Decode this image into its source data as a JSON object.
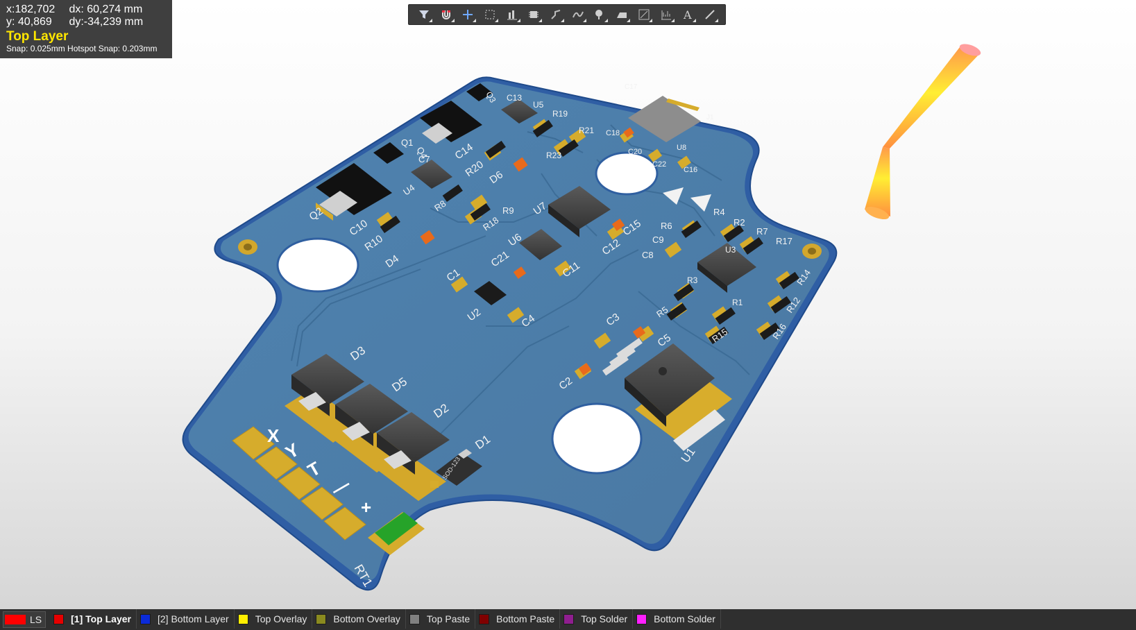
{
  "hud": {
    "x": "x:182,702",
    "dx": "dx: 60,274  mm",
    "y": "y: 40,869",
    "dy": "dy:-34,239  mm",
    "layer": "Top Layer",
    "snap": "Snap: 0.025mm Hotspot Snap: 0.203mm"
  },
  "toolbar": [
    {
      "name": "filter-icon"
    },
    {
      "name": "snap-magnet-icon"
    },
    {
      "name": "crosshair-icon"
    },
    {
      "name": "select-rect-icon"
    },
    {
      "name": "align-icon"
    },
    {
      "name": "component-icon"
    },
    {
      "name": "route-icon"
    },
    {
      "name": "diff-pair-icon"
    },
    {
      "name": "via-icon"
    },
    {
      "name": "polygon-icon"
    },
    {
      "name": "dimension-icon"
    },
    {
      "name": "graph-icon"
    },
    {
      "name": "text-icon"
    },
    {
      "name": "line-icon"
    }
  ],
  "silkscreen": {
    "labels": [
      "Q3",
      "C13",
      "U5",
      "R19",
      "R21",
      "C14",
      "R20",
      "D6",
      "R23",
      "Q4",
      "Q1",
      "C7",
      "U4",
      "R8",
      "R9",
      "R18",
      "Q2",
      "C10",
      "R10",
      "D4",
      "U7",
      "C15",
      "C12",
      "U6",
      "C21",
      "C11",
      "C1",
      "U2",
      "C4",
      "C18",
      "C20",
      "C22",
      "U8",
      "C16",
      "J1",
      "C17",
      "R4",
      "R6",
      "R2",
      "R7",
      "R17",
      "C9",
      "C8",
      "U3",
      "R3",
      "R5",
      "R1",
      "R14",
      "R12",
      "R15",
      "R16",
      "C3",
      "C5",
      "C2",
      "U1",
      "D3",
      "D5",
      "D2",
      "D1",
      "RT1",
      "SOD-123"
    ],
    "pin_marks": [
      "X",
      "Y",
      "T",
      "—",
      "+"
    ]
  },
  "layer_bar": {
    "ls_label": "LS",
    "ls_color": "#ff0000",
    "tabs": [
      {
        "label": "[1] Top Layer",
        "color": "#e60000",
        "active": true
      },
      {
        "label": "[2] Bottom Layer",
        "color": "#0b2bd9",
        "active": false
      },
      {
        "label": "Top Overlay",
        "color": "#ffee00",
        "active": false
      },
      {
        "label": "Bottom Overlay",
        "color": "#8a8a1f",
        "active": false
      },
      {
        "label": "Top Paste",
        "color": "#808080",
        "active": false
      },
      {
        "label": "Bottom Paste",
        "color": "#800000",
        "active": false
      },
      {
        "label": "Top Solder",
        "color": "#8f1e8f",
        "active": false
      },
      {
        "label": "Bottom Solder",
        "color": "#ff20ff",
        "active": false
      }
    ]
  },
  "colors": {
    "board": "#4d7ea8",
    "board_edge": "#2f5fa0",
    "pad": "#d9aa27",
    "silk": "#f2f2f2"
  }
}
